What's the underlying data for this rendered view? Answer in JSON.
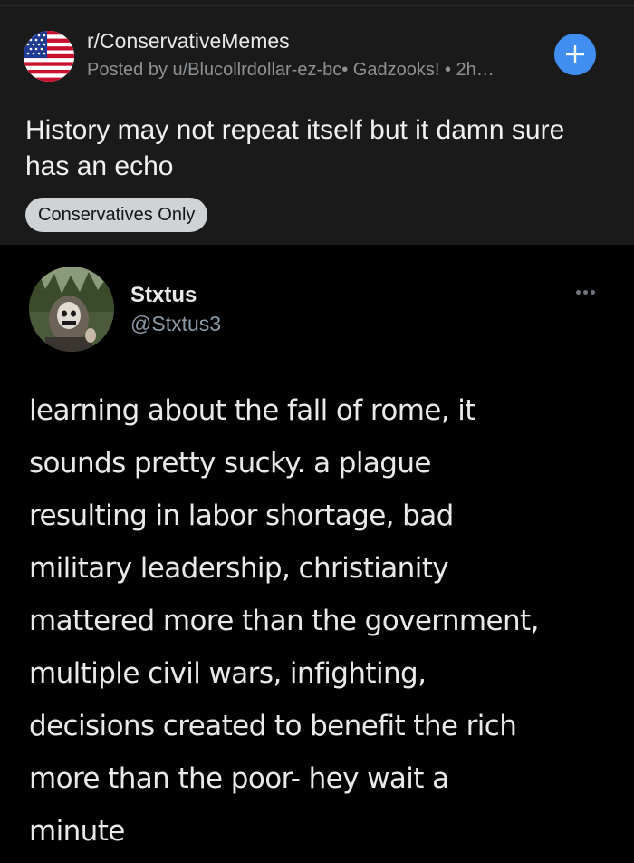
{
  "post": {
    "subreddit": "r/ConservativeMemes",
    "posted_by": "Posted by u/Blucollrdollar-ez-bc• Gadzooks! • 2h…",
    "title": "History may not repeat itself but it damn sure has an echo",
    "flair": "Conservatives Only",
    "join_icon": "plus-icon",
    "subreddit_icon": "us-flag-icon"
  },
  "tweet": {
    "display_name": "Stxtus",
    "handle": "@Stxtus3",
    "more_icon": "ellipsis-icon",
    "text_lines": [
      "learning about the fall of rome, it",
      "sounds pretty sucky. a plague",
      "resulting in labor shortage, bad",
      "military leadership, christianity",
      "mattered more than the government,",
      "multiple civil wars, infighting,",
      "decisions created to benefit the rich",
      "more than the poor- hey wait a",
      "minute"
    ]
  },
  "colors": {
    "header_bg": "#1a1a1b",
    "tweet_bg": "#000000",
    "accent_blue": "#3f8ef0",
    "flair_bg": "#d0d3d6"
  }
}
